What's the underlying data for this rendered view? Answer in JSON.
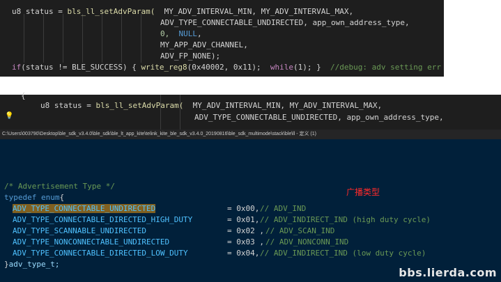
{
  "top_editor": {
    "line1_prefix": "u8 status = ",
    "line1_fn": "bls_ll_setAdvParam(",
    "line1_args": "  MY_ADV_INTERVAL_MIN, MY_ADV_INTERVAL_MAX,",
    "line2": "ADV_TYPE_CONNECTABLE_UNDIRECTED, app_own_address_type,",
    "line3_a": "0,  ",
    "line3_null": "NULL",
    "line3_b": ",",
    "line4": "MY_APP_ADV_CHANNEL,",
    "line5": "ADV_FP_NONE);",
    "line6_if": "if",
    "line6_cond": "(status != BLE_SUCCESS) { ",
    "line6_fn": "write_reg8",
    "line6_args": "(0x40002, 0x11);  ",
    "line6_while": "while",
    "line6_rest": "(1); }  ",
    "line6_comment": "//debug: adv setting err"
  },
  "mid_editor": {
    "brace": "{",
    "line1_prefix": "u8 status = ",
    "line1_fn": "bls_ll_setAdvParam(",
    "line1_args": "  MY_ADV_INTERVAL_MIN, MY_ADV_INTERVAL_MAX,",
    "line2": "ADV_TYPE_CONNECTABLE_UNDIRECTED, app_own_address_type,",
    "bulb_icon": "lightbulb-icon"
  },
  "path_bar": {
    "text": "C:\\Users\\003790\\Desktop\\ble_sdk_v3.4.0\\ble_sdk\\ble_lt_app_kite\\telink_kite_ble_sdk_v3.4.0_20190816\\ble_sdk_multimode\\stack\\ble\\ll - 定义 (1)"
  },
  "enum_view": {
    "comment": "/* Advertisement Type */",
    "typedef_kw": "typedef enum",
    "open_brace": "{",
    "items": [
      {
        "name": "ADV_TYPE_CONNECTABLE_UNDIRECTED",
        "value": "= 0x00,",
        "comment": "// ADV_IND"
      },
      {
        "name": "ADV_TYPE_CONNECTABLE_DIRECTED_HIGH_DUTY",
        "value": "= 0x01,",
        "comment": "// ADV_INDIRECT_IND (high duty cycle)"
      },
      {
        "name": "ADV_TYPE_SCANNABLE_UNDIRECTED",
        "value": "= 0x02 ,",
        "comment": "// ADV_SCAN_IND"
      },
      {
        "name": "ADV_TYPE_NONCONNECTABLE_UNDIRECTED",
        "value": "= 0x03 ,",
        "comment": "// ADV_NONCONN_IND"
      },
      {
        "name": "ADV_TYPE_CONNECTABLE_DIRECTED_LOW_DUTY",
        "value": "= 0x04,",
        "comment": "// ADV_INDIRECT_IND (low duty cycle)"
      }
    ],
    "close": "}",
    "type_name": "adv_type_t;",
    "annotation_cn": "广播类型"
  },
  "watermark": "bbs.lierda.com"
}
